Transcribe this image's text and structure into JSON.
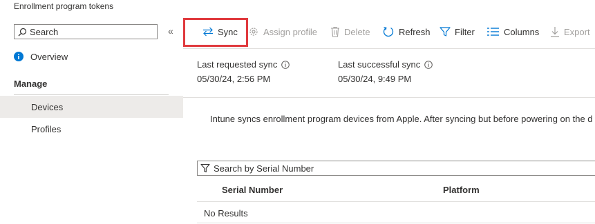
{
  "breadcrumb": "Enrollment program tokens",
  "sidebar": {
    "search_placeholder": "Search",
    "collapse_glyph": "«",
    "overview_label": "Overview",
    "manage_title": "Manage",
    "items": [
      {
        "label": "Devices",
        "selected": true
      },
      {
        "label": "Profiles",
        "selected": false
      }
    ]
  },
  "toolbar": {
    "sync": "Sync",
    "assign_profile": "Assign profile",
    "delete": "Delete",
    "refresh": "Refresh",
    "filter": "Filter",
    "columns": "Columns",
    "export": "Export"
  },
  "sync_info": {
    "last_requested_label": "Last requested sync",
    "last_requested_value": "05/30/24, 2:56 PM",
    "last_successful_label": "Last successful sync",
    "last_successful_value": "05/30/24, 9:49 PM"
  },
  "description": "Intune syncs enrollment program devices from Apple. After syncing but before powering on the d",
  "grid": {
    "search_placeholder": "Search by Serial Number",
    "columns": [
      "Serial Number",
      "Platform"
    ],
    "empty_text": "No Results"
  },
  "colors": {
    "accent": "#0078d4",
    "highlight": "#e03a3e",
    "selected_bg": "#edebe9"
  }
}
